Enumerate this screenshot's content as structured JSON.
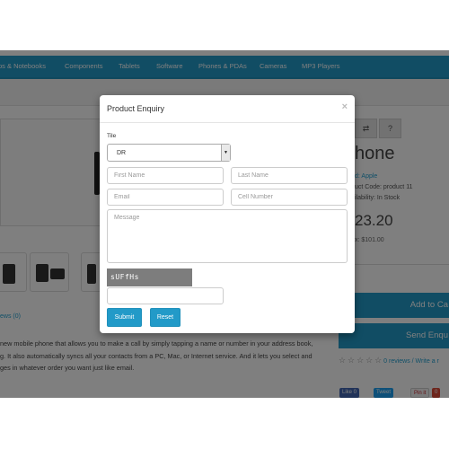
{
  "nav": {
    "items": [
      "ps & Notebooks",
      "Components",
      "Tablets",
      "Software",
      "Phones & PDAs",
      "Cameras",
      "MP3 Players"
    ]
  },
  "product": {
    "title": "hone",
    "brand": "d: Apple",
    "code": "uct Code: product 11",
    "availability": "ilability: In Stock",
    "price": "23.20",
    "ex_tax": "x: $101.00",
    "add_to_cart": "Add to Ca",
    "send_enquiry": "Send Enqu",
    "compare_icon": "exchange-icon",
    "info_icon": "info-icon",
    "reviews_summary": "0 reviews / Write a r",
    "reviews_link": "ews (0)",
    "star_glyph": "☆",
    "description_lines": [
      "new mobile phone that allows you to make a call by simply tapping a name or number in your address book,",
      "g. It also automatically syncs all your contacts from a PC, Mac, or Internet service. And it lets you select and",
      "ges in whatever order you want just like email."
    ],
    "share": [
      "Like 0",
      "Tweet",
      "Pin it",
      "0"
    ]
  },
  "modal": {
    "title": "Product Enquiry",
    "close": "×",
    "title_field_label": "Tile",
    "title_select_value": "DR",
    "first_name_placeholder": "First Name",
    "last_name_placeholder": "Last Name",
    "email_placeholder": "Email",
    "cell_placeholder": "Cell Number",
    "message_placeholder": "Message",
    "captcha_text": "sUFfHs",
    "captcha_input_value": "",
    "submit_label": "Submit",
    "reset_label": "Reset"
  },
  "colors": {
    "accent": "#229ac8",
    "overlay": "rgba(0,0,0,0.5)",
    "link": "#23a1d1"
  }
}
